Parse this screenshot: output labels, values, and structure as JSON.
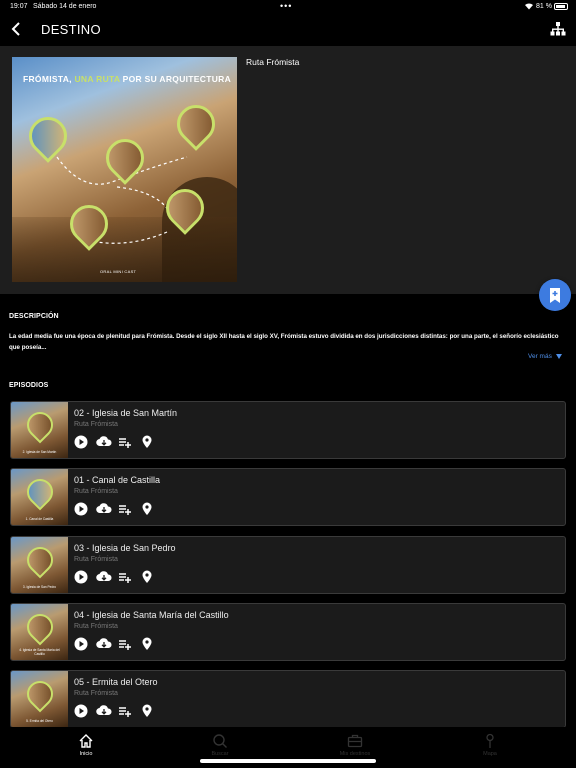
{
  "status": {
    "time": "19:07",
    "date": "Sábado 14 de enero",
    "battery": "81 %"
  },
  "nav": {
    "title": "DESTINO"
  },
  "hero": {
    "title": "Ruta Frómista",
    "cover_title_a": "FRÓMISTA, ",
    "cover_title_b": "UNA RUTA",
    "cover_title_c": " POR SU ARQUITECTURA",
    "cover_credit": "ORAL MINI CAST"
  },
  "description": {
    "heading": "DESCRIPCIÓN",
    "text": "La edad media fue una época de plenitud para Frómista. Desde el siglo XII hasta el siglo XV, Frómista estuvo dividida en dos jurisdicciones distintas: por una parte, el señorío eclesiástico que poseía...",
    "more": "Ver más"
  },
  "episodes": {
    "heading": "EPISODIOS",
    "items": [
      {
        "title": "02 - Iglesia de San Martín",
        "subtitle": "Ruta Frómista",
        "caption": "2. Iglesia de San Martín"
      },
      {
        "title": "01 - Canal de Castilla",
        "subtitle": "Ruta Frómista",
        "caption": "1. Canal de Castilla"
      },
      {
        "title": "03 - Iglesia de San Pedro",
        "subtitle": "Ruta Frómista",
        "caption": "3. Iglesia de San Pedro"
      },
      {
        "title": "04 - Iglesia de Santa María del Castillo",
        "subtitle": "Ruta Frómista",
        "caption": "4. Iglesia de Santa María del Castillo"
      },
      {
        "title": "05 - Ermita del Otero",
        "subtitle": "Ruta Frómista",
        "caption": "5. Ermita del Otero"
      }
    ]
  },
  "tabs": [
    {
      "label": "Inicio",
      "icon": "home-icon",
      "active": true
    },
    {
      "label": "Buscar",
      "icon": "search-icon",
      "active": false
    },
    {
      "label": "Mis destinos",
      "icon": "briefcase-icon",
      "active": false
    },
    {
      "label": "Mapa",
      "icon": "map-pin-icon",
      "active": false
    }
  ],
  "colors": {
    "accent": "#3d7be0",
    "link": "#4f8fe8",
    "highlight": "#c8e06a"
  }
}
